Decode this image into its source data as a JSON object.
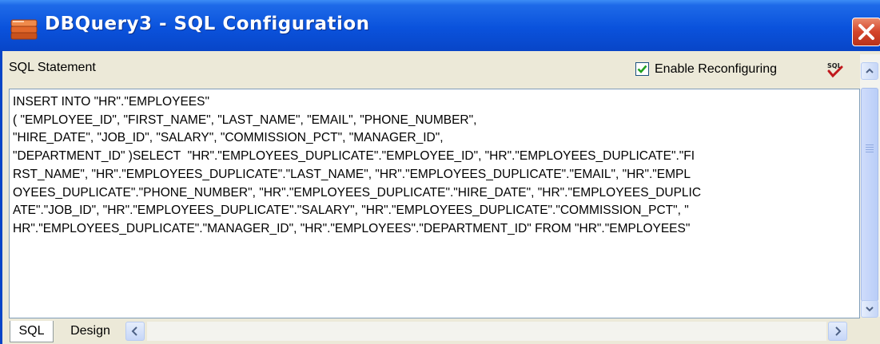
{
  "window": {
    "title": "DBQuery3 - SQL Configuration",
    "icons": {
      "app": "database-icon",
      "close": "close-icon"
    }
  },
  "header": {
    "label": "SQL Statement",
    "checkbox_label": "Enable Reconfiguring",
    "checkbox_checked": true,
    "sql_icon": "sql-check-icon"
  },
  "editor": {
    "lines": [
      "INSERT INTO \"HR\".\"EMPLOYEES\"",
      "( \"EMPLOYEE_ID\", \"FIRST_NAME\", \"LAST_NAME\", \"EMAIL\", \"PHONE_NUMBER\",",
      "\"HIRE_DATE\", \"JOB_ID\", \"SALARY\", \"COMMISSION_PCT\", \"MANAGER_ID\",",
      "\"DEPARTMENT_ID\" )SELECT  \"HR\".\"EMPLOYEES_DUPLICATE\".\"EMPLOYEE_ID\", \"HR\".\"EMPLOYEES_DUPLICATE\".\"FI",
      "RST_NAME\", \"HR\".\"EMPLOYEES_DUPLICATE\".\"LAST_NAME\", \"HR\".\"EMPLOYEES_DUPLICATE\".\"EMAIL\", \"HR\".\"EMPL",
      "OYEES_DUPLICATE\".\"PHONE_NUMBER\", \"HR\".\"EMPLOYEES_DUPLICATE\".\"HIRE_DATE\", \"HR\".\"EMPLOYEES_DUPLIC",
      "ATE\".\"JOB_ID\", \"HR\".\"EMPLOYEES_DUPLICATE\".\"SALARY\", \"HR\".\"EMPLOYEES_DUPLICATE\".\"COMMISSION_PCT\", \"",
      "HR\".\"EMPLOYEES_DUPLICATE\".\"MANAGER_ID\", \"HR\".\"EMPLOYEES\".\"DEPARTMENT_ID\" FROM \"HR\".\"EMPLOYEES\""
    ]
  },
  "tabs": [
    {
      "label": "SQL",
      "active": true
    },
    {
      "label": "Design",
      "active": false
    }
  ],
  "colors": {
    "titlebar": "#0a52dc",
    "close": "#d4452a",
    "check": "#21a121"
  }
}
